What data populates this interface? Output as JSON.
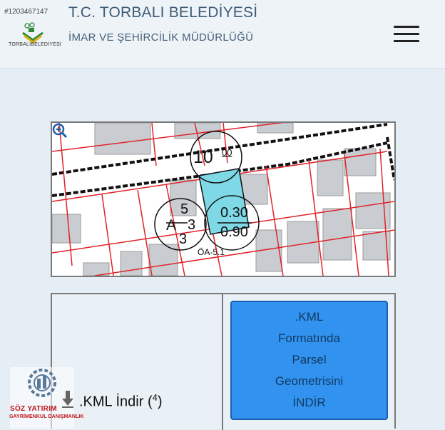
{
  "listing_id": "#1203467147",
  "municipality": {
    "title": "T.C. TORBALI BELEDİYESİ",
    "subtitle": "İMAR VE ŞEHİRCİLİK MÜDÜRLÜĞÜ",
    "logo_text": "TORBALIBELEDİYESİ"
  },
  "menu": {
    "icon": "hamburger-menu-icon"
  },
  "map": {
    "height_label": "10",
    "height_sup": "00",
    "zone_letter": "A",
    "zone_top": "5",
    "zone_mid": "3",
    "zone_bottom": "3",
    "ratio_top": "0.30",
    "ratio_bottom": "0.90",
    "zone_code": "ÖA-5.1",
    "parcel_color": "#7fd8e6",
    "zoom_icon": "zoom-in-icon"
  },
  "kml": {
    "button_lines": [
      ".KML",
      "Formatında",
      "Parsel",
      "Geometrisini",
      "İNDİR"
    ],
    "download_label": ".KML İndir (",
    "download_count": "4",
    "download_close": ")",
    "button_color": "#3193ef"
  },
  "watermark": {
    "name": "SÖZ YATIRIM",
    "subtitle": "GAYRİMENKUL DANIŞMANLIK"
  }
}
